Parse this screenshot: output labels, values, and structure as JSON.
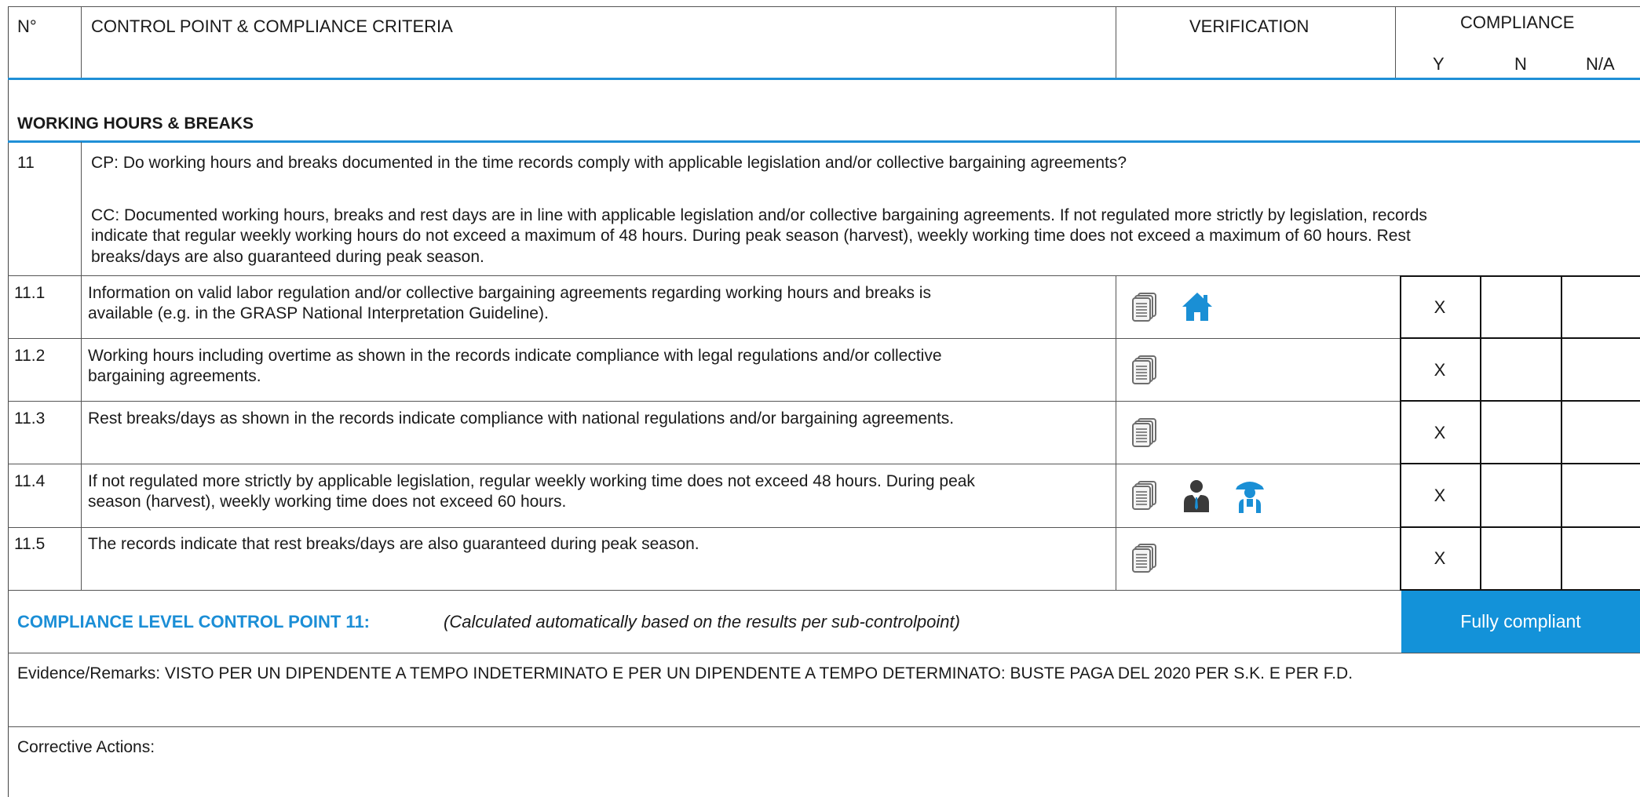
{
  "header": {
    "no": "N°",
    "cp_cc": "CONTROL POINT & COMPLIANCE CRITERIA",
    "verification": "VERIFICATION",
    "compliance": "COMPLIANCE",
    "y": "Y",
    "n": "N",
    "na": "N/A"
  },
  "section": {
    "title": "WORKING HOURS & BREAKS"
  },
  "control_point": {
    "number": "11",
    "cp": "CP: Do working hours and breaks documented in the time records comply with applicable legislation and/or collective bargaining agreements?",
    "cc_line1": "CC: Documented working hours, breaks and rest days are in line with applicable legislation and/or collective bargaining agreements. If not regulated more strictly by legislation, records",
    "cc_line2": "indicate that regular weekly working hours do not exceed a maximum of 48 hours. During peak season (harvest), weekly working time does not exceed a maximum of 60 hours. Rest",
    "cc_line3": "breaks/days are also guaranteed during peak season."
  },
  "rows": [
    {
      "no": "11.1",
      "line1": "Information on valid labor regulation and/or collective bargaining agreements regarding working hours and breaks is",
      "line2": "available (e.g. in the GRASP National Interpretation Guideline).",
      "icons": [
        "document-icon",
        "home-icon"
      ],
      "y": "X",
      "n": "",
      "na": ""
    },
    {
      "no": "11.2",
      "line1": "Working hours including overtime as shown in the records indicate compliance with legal regulations and/or collective",
      "line2": "bargaining agreements.",
      "icons": [
        "document-icon"
      ],
      "y": "X",
      "n": "",
      "na": ""
    },
    {
      "no": "11.3",
      "line1": "Rest breaks/days as shown in the records indicate compliance with national regulations and/or bargaining agreements.",
      "line2": "",
      "icons": [
        "document-icon"
      ],
      "y": "X",
      "n": "",
      "na": ""
    },
    {
      "no": "11.4",
      "line1": "If not regulated more strictly by applicable legislation, regular weekly working time does not exceed 48 hours. During peak",
      "line2": "season (harvest), weekly working time does not exceed 60 hours.",
      "icons": [
        "document-icon",
        "manager-icon",
        "worker-icon"
      ],
      "y": "X",
      "n": "",
      "na": ""
    },
    {
      "no": "11.5",
      "line1": "The records indicate that rest breaks/days are also guaranteed during peak season.",
      "line2": "",
      "icons": [
        "document-icon"
      ],
      "y": "X",
      "n": "",
      "na": ""
    }
  ],
  "compliance_level": {
    "label": "COMPLIANCE LEVEL CONTROL POINT 11:",
    "note": "(Calculated automatically based on the results per sub-controlpoint)",
    "result": "Fully compliant",
    "result_color": "#1392d9"
  },
  "evidence": "Evidence/Remarks: VISTO PER UN DIPENDENTE A TEMPO INDETERMINATO E PER UN DIPENDENTE A TEMPO DETERMINATO: BUSTE PAGA DEL 2020 PER S.K. E PER F.D.",
  "corrective": "Corrective Actions:",
  "colors": {
    "accent_blue": "#1b8ed6",
    "icon_blue": "#1a8fd5",
    "icon_dark": "#3a3a3a"
  }
}
